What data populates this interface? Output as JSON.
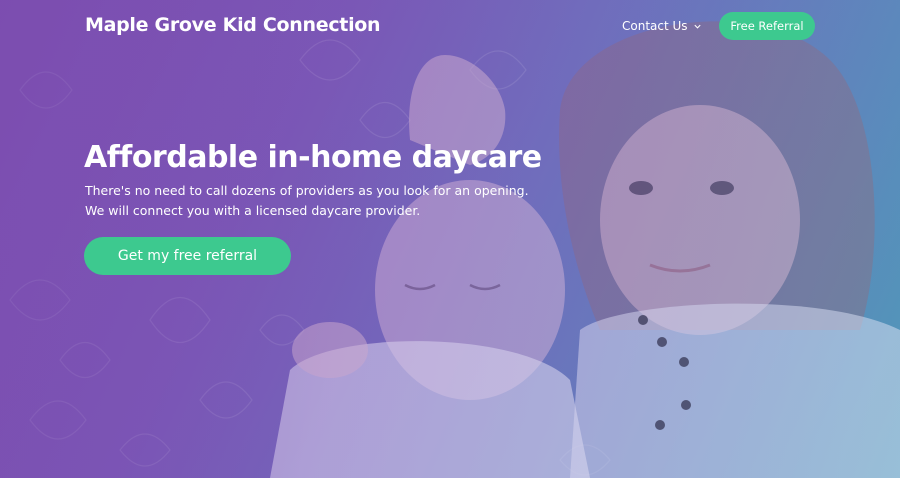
{
  "nav": {
    "brand": "Maple Grove Kid Connection",
    "contact_label": "Contact Us",
    "referral_label": "Free Referral"
  },
  "hero": {
    "headline": "Affordable in-home daycare",
    "sub_line_1": "There's no need to call dozens of providers as you look for an opening.",
    "sub_line_2": "We will connect you with a licensed daycare provider.",
    "cta_label": "Get my free referral"
  },
  "colors": {
    "accent": "#3dc98f",
    "overlay_purple": "#7b4fb0",
    "overlay_teal": "#4f9ab8"
  },
  "icons": {
    "contact_dropdown": "chevron-down-icon"
  }
}
